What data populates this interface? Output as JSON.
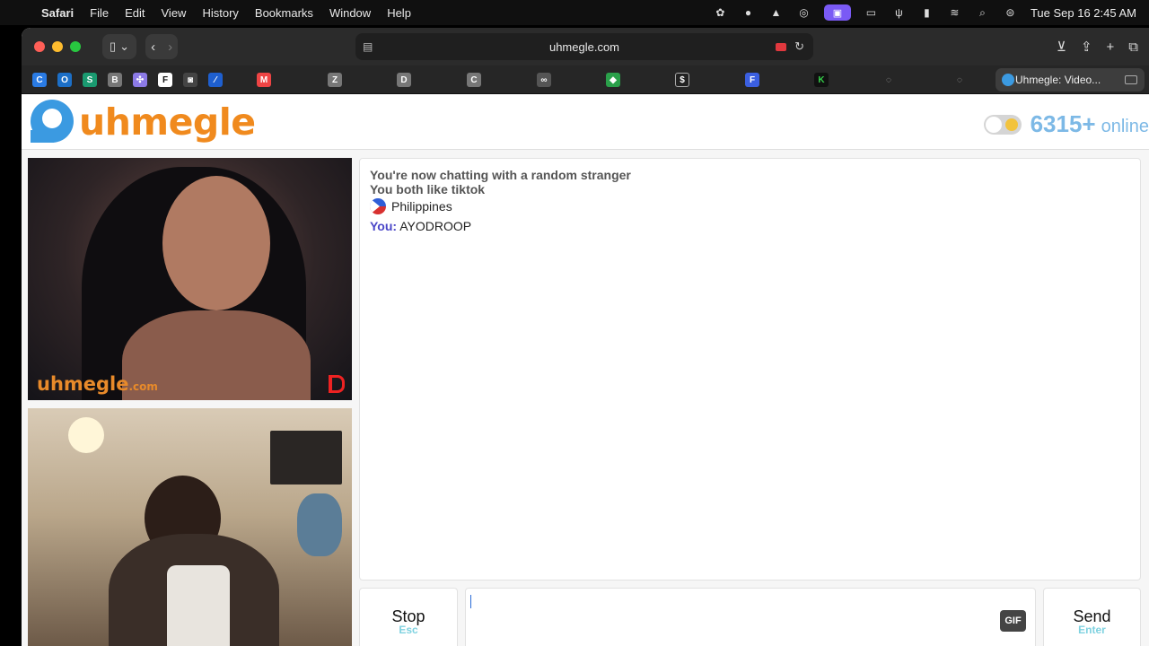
{
  "menubar": {
    "app": "Safari",
    "menus": [
      "File",
      "Edit",
      "View",
      "History",
      "Bookmarks",
      "Window",
      "Help"
    ],
    "clock": "Tue Sep 16  2:45 AM"
  },
  "browser": {
    "url": "uhmegle.com",
    "active_tab": "Uhmegle: Video..."
  },
  "site": {
    "logo": "uhmegle",
    "online_count": "6315+",
    "online_label": "online",
    "watermark": "uhmegle",
    "watermark_suffix": ".com"
  },
  "chat": {
    "status": "You're now chatting with a random stranger",
    "interest": "You both like tiktok",
    "country": "Philippines",
    "you_label": "You:",
    "you_message": "AYODROOP"
  },
  "controls": {
    "stop_label": "Stop",
    "stop_hint": "Esc",
    "send_label": "Send",
    "send_hint": "Enter",
    "gif_label": "GIF"
  },
  "colors": {
    "brand_orange": "#f08a1e",
    "brand_blue": "#3b9ae1",
    "you_color": "#4a46c8",
    "hint_color": "#7fd2e0"
  }
}
